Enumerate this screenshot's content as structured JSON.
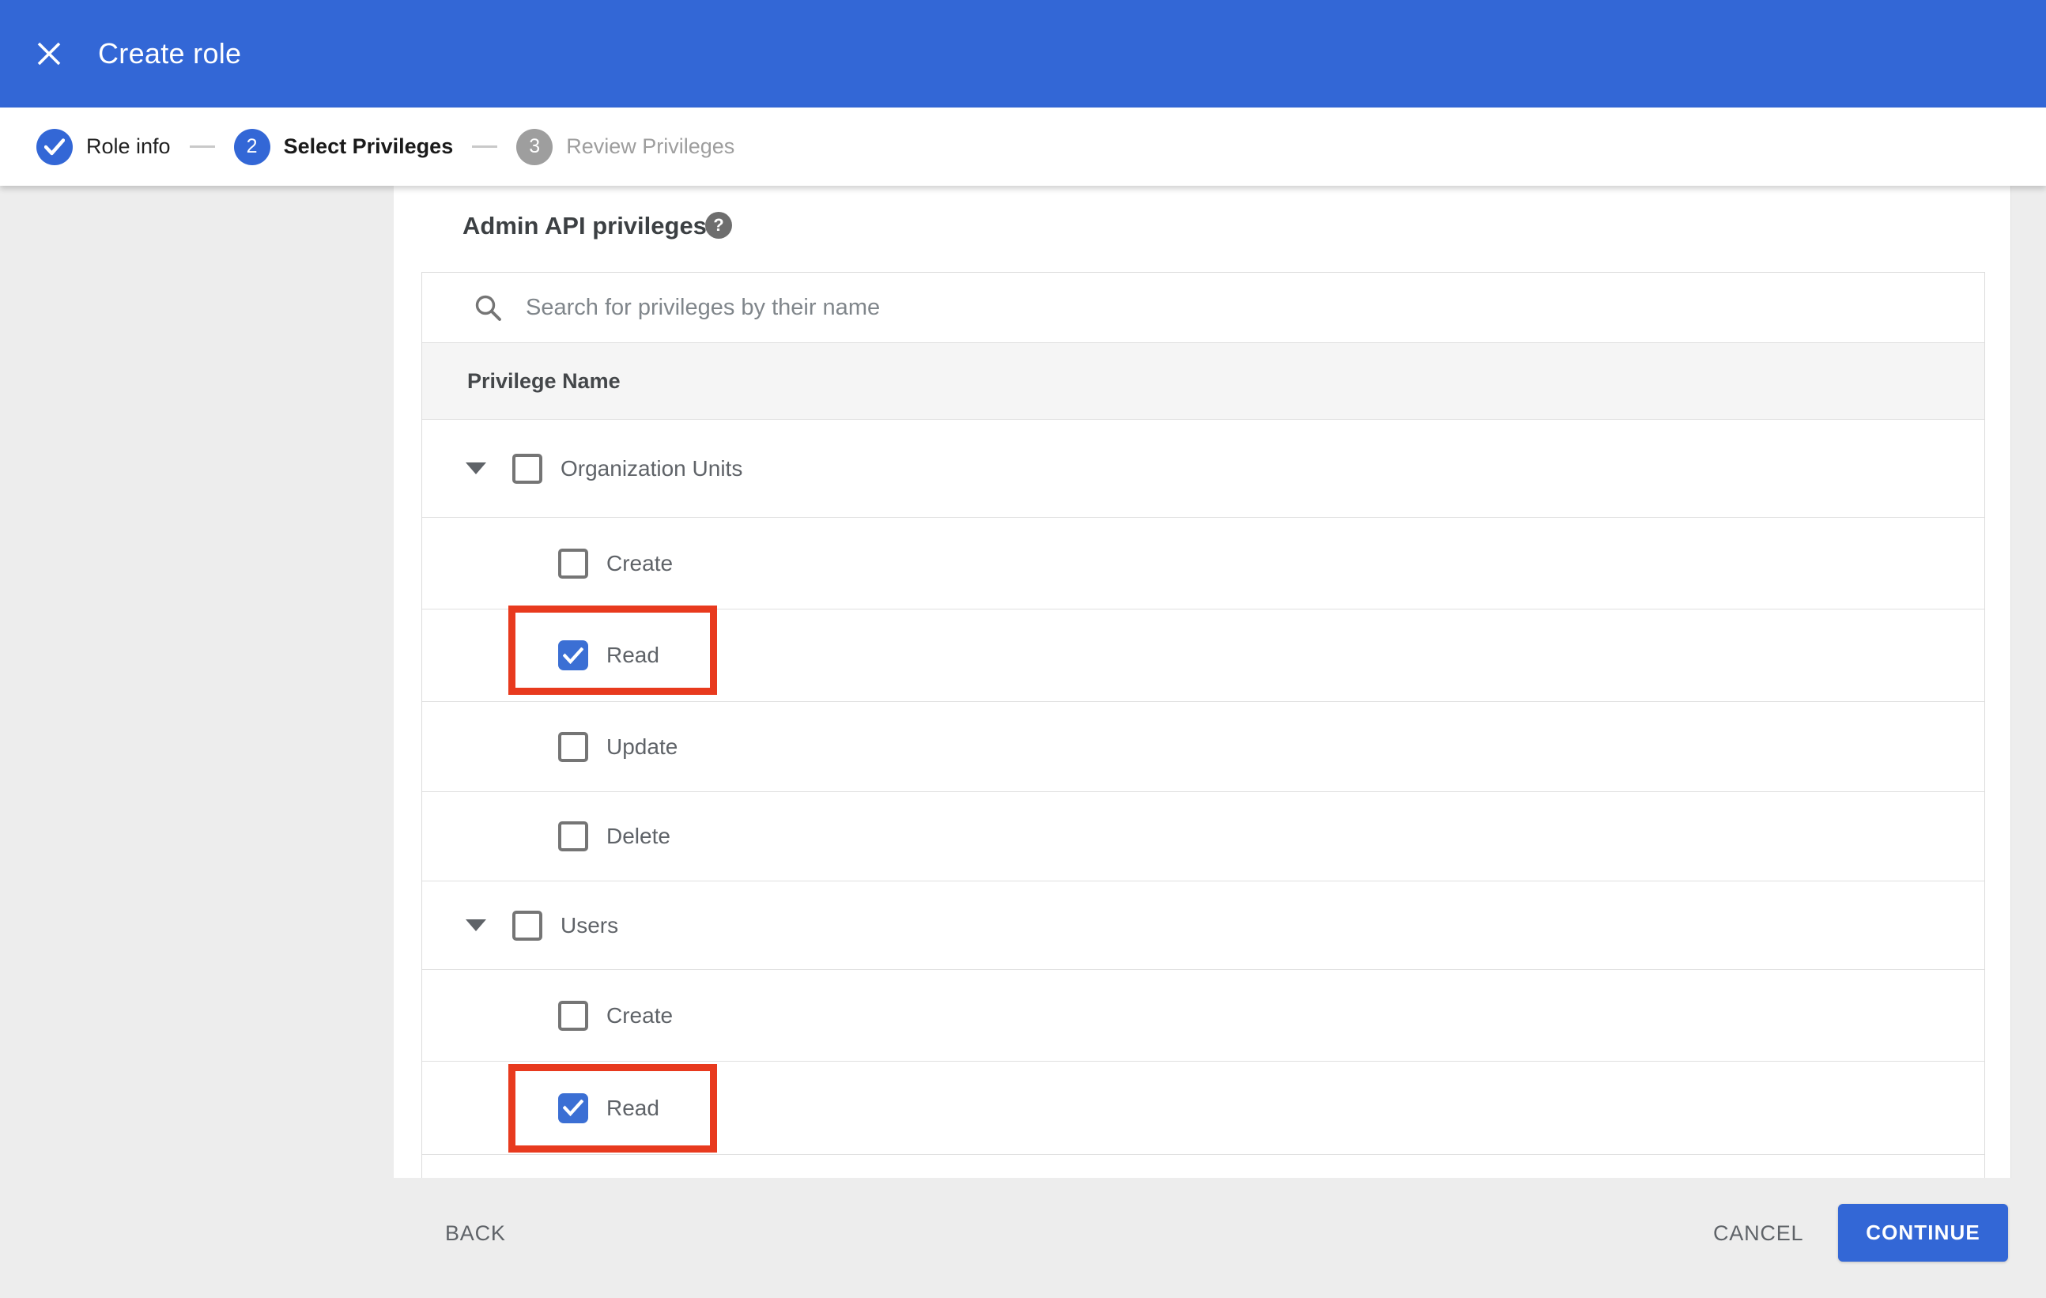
{
  "appbar": {
    "title": "Create role"
  },
  "stepper": {
    "steps": [
      {
        "number": "",
        "label": "Role info",
        "state": "done"
      },
      {
        "number": "2",
        "label": "Select Privileges",
        "state": "active"
      },
      {
        "number": "3",
        "label": "Review Privileges",
        "state": "upcoming"
      }
    ]
  },
  "panel": {
    "heading": "Admin API privileges",
    "help_icon": "?",
    "search": {
      "placeholder": "Search for privileges by their name",
      "value": ""
    },
    "table": {
      "header": "Privilege Name",
      "rows": [
        {
          "label": "Organization Units",
          "level": 0,
          "expanded": true,
          "checked": false,
          "highlighted": false
        },
        {
          "label": "Create",
          "level": 1,
          "checked": false,
          "highlighted": false
        },
        {
          "label": "Read",
          "level": 1,
          "checked": true,
          "highlighted": true
        },
        {
          "label": "Update",
          "level": 1,
          "checked": false,
          "highlighted": false
        },
        {
          "label": "Delete",
          "level": 1,
          "checked": false,
          "highlighted": false
        },
        {
          "label": "Users",
          "level": 0,
          "expanded": true,
          "checked": false,
          "highlighted": false
        },
        {
          "label": "Create",
          "level": 1,
          "checked": false,
          "highlighted": false
        },
        {
          "label": "Read",
          "level": 1,
          "checked": true,
          "highlighted": true
        }
      ]
    }
  },
  "footer": {
    "back": "BACK",
    "cancel": "CANCEL",
    "continue": "CONTINUE"
  },
  "colors": {
    "primary_blue": "#3367d6",
    "checkbox_blue": "#3b6fd4",
    "highlight_red": "#e83a1e",
    "page_gray": "#ededed",
    "table_header_gray": "#f5f5f5",
    "divider_gray": "#e0e0e0"
  }
}
